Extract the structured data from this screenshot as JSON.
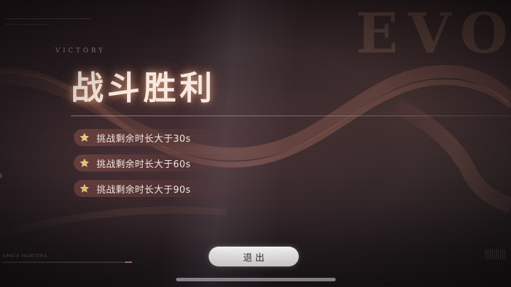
{
  "background": {
    "watermark": "EVO",
    "accent_color": "#e8a07a"
  },
  "result": {
    "subtitle": "VICTORY",
    "title": "战斗胜利"
  },
  "conditions": [
    {
      "icon": "star-icon",
      "text": "挑战剩余时长大于30s"
    },
    {
      "icon": "star-icon",
      "text": "挑战剩余时长大于60s"
    },
    {
      "icon": "star-icon",
      "text": "挑战剩余时长大于90s"
    }
  ],
  "actions": {
    "exit_label": "退出"
  },
  "footer": {
    "corner_label": "SPACE HUNTERS",
    "progress": 0.95
  }
}
